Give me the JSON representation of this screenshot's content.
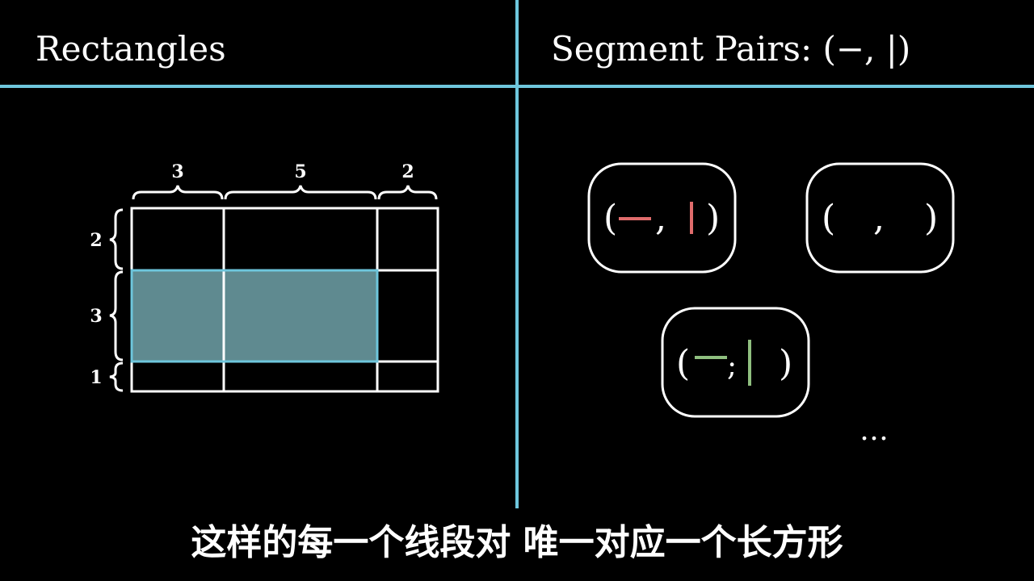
{
  "left_panel": {
    "title": "Rectangles"
  },
  "right_panel": {
    "title": "Segment Pairs: (−, |)"
  },
  "grid": {
    "column_widths": [
      "3",
      "5",
      "2"
    ],
    "row_heights": [
      "2",
      "3",
      "1"
    ],
    "highlight": {
      "rows": [
        1
      ],
      "cols": [
        0,
        1
      ]
    },
    "highlight_color": "#5f8a90",
    "highlight_border": "#6ec6dc"
  },
  "pairs": [
    {
      "open": "(",
      "comma": ",",
      "close": ")",
      "h_color": "#e06c6c",
      "v_color": "#e06c6c"
    },
    {
      "open": "(",
      "comma": ",",
      "close": ")"
    },
    {
      "open": "(",
      "comma": ";",
      "close": ")",
      "h_color": "#8fbf7f",
      "v_color": "#8fbf7f"
    }
  ],
  "ellipsis": "…",
  "divider_color": "#6ec6dc",
  "caption": "这样的每一个线段对 唯一对应一个长方形"
}
